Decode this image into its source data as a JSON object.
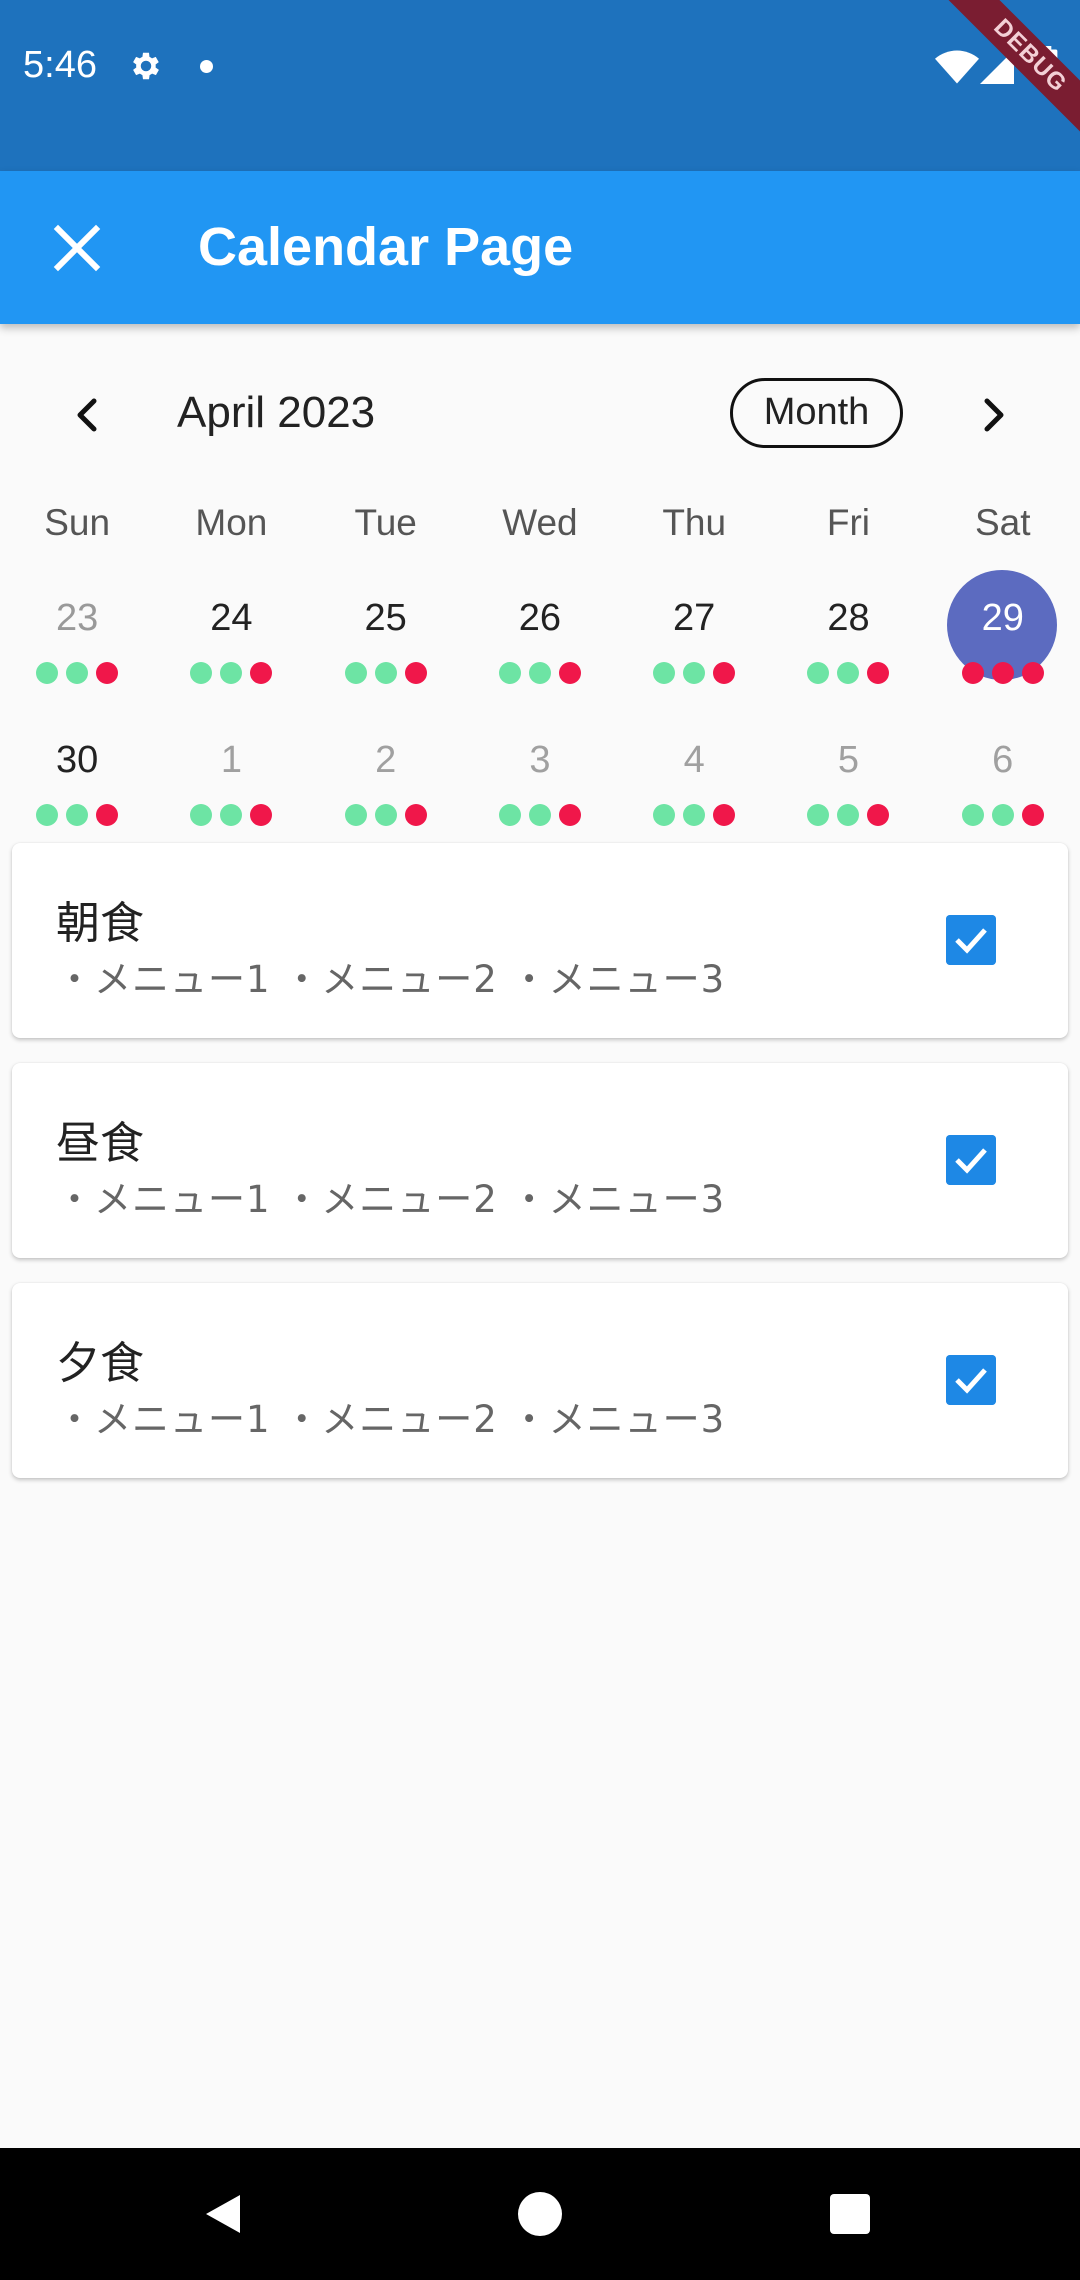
{
  "status_bar": {
    "time": "5:46",
    "debug_label": "DEBUG"
  },
  "app_bar": {
    "title": "Calendar Page"
  },
  "calendar": {
    "month_title": "April 2023",
    "format_button": "Month",
    "days_of_week": [
      "Sun",
      "Mon",
      "Tue",
      "Wed",
      "Thu",
      "Fri",
      "Sat"
    ],
    "weeks": [
      [
        {
          "day": "23",
          "style": "muted",
          "markers": [
            "green",
            "green",
            "red"
          ]
        },
        {
          "day": "24",
          "style": "normal",
          "markers": [
            "green",
            "green",
            "red"
          ]
        },
        {
          "day": "25",
          "style": "normal",
          "markers": [
            "green",
            "green",
            "red"
          ]
        },
        {
          "day": "26",
          "style": "normal",
          "markers": [
            "green",
            "green",
            "red"
          ]
        },
        {
          "day": "27",
          "style": "normal",
          "markers": [
            "green",
            "green",
            "red"
          ]
        },
        {
          "day": "28",
          "style": "normal",
          "markers": [
            "green",
            "green",
            "red"
          ]
        },
        {
          "day": "29",
          "style": "selected",
          "markers": [
            "red",
            "red",
            "red"
          ]
        }
      ],
      [
        {
          "day": "30",
          "style": "normal",
          "markers": [
            "green",
            "green",
            "red"
          ]
        },
        {
          "day": "1",
          "style": "outside",
          "markers": [
            "green",
            "green",
            "red"
          ]
        },
        {
          "day": "2",
          "style": "outside",
          "markers": [
            "green",
            "green",
            "red"
          ]
        },
        {
          "day": "3",
          "style": "outside",
          "markers": [
            "green",
            "green",
            "red"
          ]
        },
        {
          "day": "4",
          "style": "outside",
          "markers": [
            "green",
            "green",
            "red"
          ]
        },
        {
          "day": "5",
          "style": "outside",
          "markers": [
            "green",
            "green",
            "red"
          ]
        },
        {
          "day": "6",
          "style": "outside",
          "markers": [
            "green",
            "green",
            "red"
          ]
        }
      ]
    ],
    "colors": {
      "selected": "#5c6bc0",
      "marker_green": "#6de4a4",
      "marker_red": "#f0174a"
    }
  },
  "meals": [
    {
      "title": "朝食",
      "menu": "・メニュー1 ・メニュー2 ・メニュー3",
      "checked": true
    },
    {
      "title": "昼食",
      "menu": "・メニュー1 ・メニュー2 ・メニュー3",
      "checked": true
    },
    {
      "title": "夕食",
      "menu": "・メニュー1 ・メニュー2 ・メニュー3",
      "checked": true
    }
  ],
  "colors": {
    "status_bar": "#1e72bd",
    "app_bar": "#2196f3",
    "checkbox": "#1e88e5"
  },
  "icons": {
    "close": "close-icon",
    "prev": "chevron-left-icon",
    "next": "chevron-right-icon",
    "settings": "gear-icon",
    "wifi": "wifi-icon",
    "signal": "signal-icon",
    "battery": "battery-icon",
    "nav_back": "back-icon",
    "nav_home": "home-icon",
    "nav_recents": "recents-icon"
  }
}
